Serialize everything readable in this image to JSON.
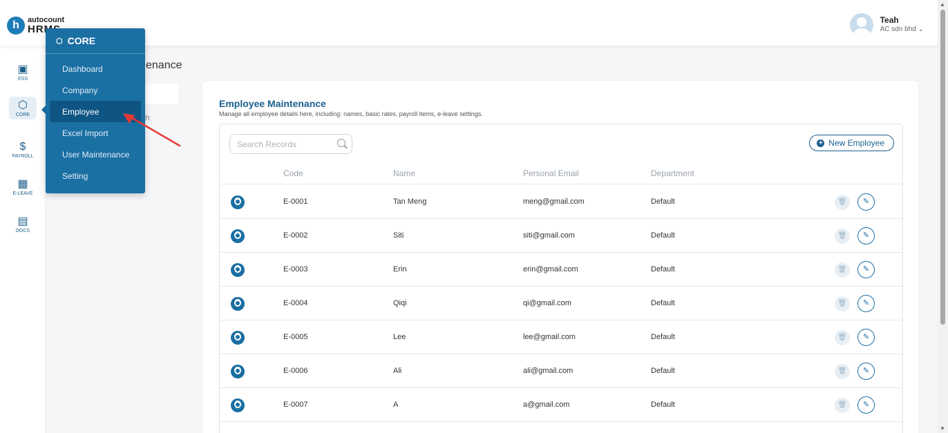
{
  "app": {
    "logo_top": "autocount",
    "logo_bottom": "HRMS",
    "logo_badge": "h"
  },
  "user": {
    "name": "Teah",
    "company": "AC sdn bhd ⌄"
  },
  "rail": [
    {
      "label": "ESS",
      "icon": "ess-icon",
      "glyph": "▣"
    },
    {
      "label": "CORE",
      "icon": "core-icon",
      "glyph": "⬡"
    },
    {
      "label": "PAYROLL",
      "icon": "payroll-icon",
      "glyph": "$"
    },
    {
      "label": "E-LEAVE",
      "icon": "calendar-icon",
      "glyph": "▦"
    },
    {
      "label": "DOCS",
      "icon": "docs-icon",
      "glyph": "▤"
    }
  ],
  "background": {
    "title_fragment": "enance",
    "text_fragment": "n"
  },
  "flyout": {
    "title": "CORE",
    "items": [
      "Dashboard",
      "Company",
      "Employee",
      "Excel Import",
      "User Maintenance",
      "Setting"
    ],
    "active": "Employee"
  },
  "main": {
    "title": "Employee Maintenance",
    "subtitle": "Manage all employee details here, including: names, basic rates, payroll items, e-leave settings.",
    "search_placeholder": "Search Records",
    "new_button": "New Employee",
    "columns": {
      "code": "Code",
      "name": "Name",
      "email": "Personal Email",
      "department": "Department"
    },
    "rows": [
      {
        "code": "E-0001",
        "name": "Tan Meng",
        "email": "meng@gmail.com",
        "department": "Default"
      },
      {
        "code": "E-0002",
        "name": "Siti",
        "email": "siti@gmail.com",
        "department": "Default"
      },
      {
        "code": "E-0003",
        "name": "Erin",
        "email": "erin@gmail.com",
        "department": "Default"
      },
      {
        "code": "E-0004",
        "name": "Qiqi",
        "email": "qi@gmail.com",
        "department": "Default"
      },
      {
        "code": "E-0005",
        "name": "Lee",
        "email": "lee@gmail.com",
        "department": "Default"
      },
      {
        "code": "E-0006",
        "name": "Ali",
        "email": "ali@gmail.com",
        "department": "Default"
      },
      {
        "code": "E-0007",
        "name": "A",
        "email": "a@gmail.com",
        "department": "Default"
      }
    ]
  },
  "colors": {
    "primary": "#1a6fa3",
    "accent_dark": "#1a5f8e",
    "annotation": "#e53935"
  }
}
